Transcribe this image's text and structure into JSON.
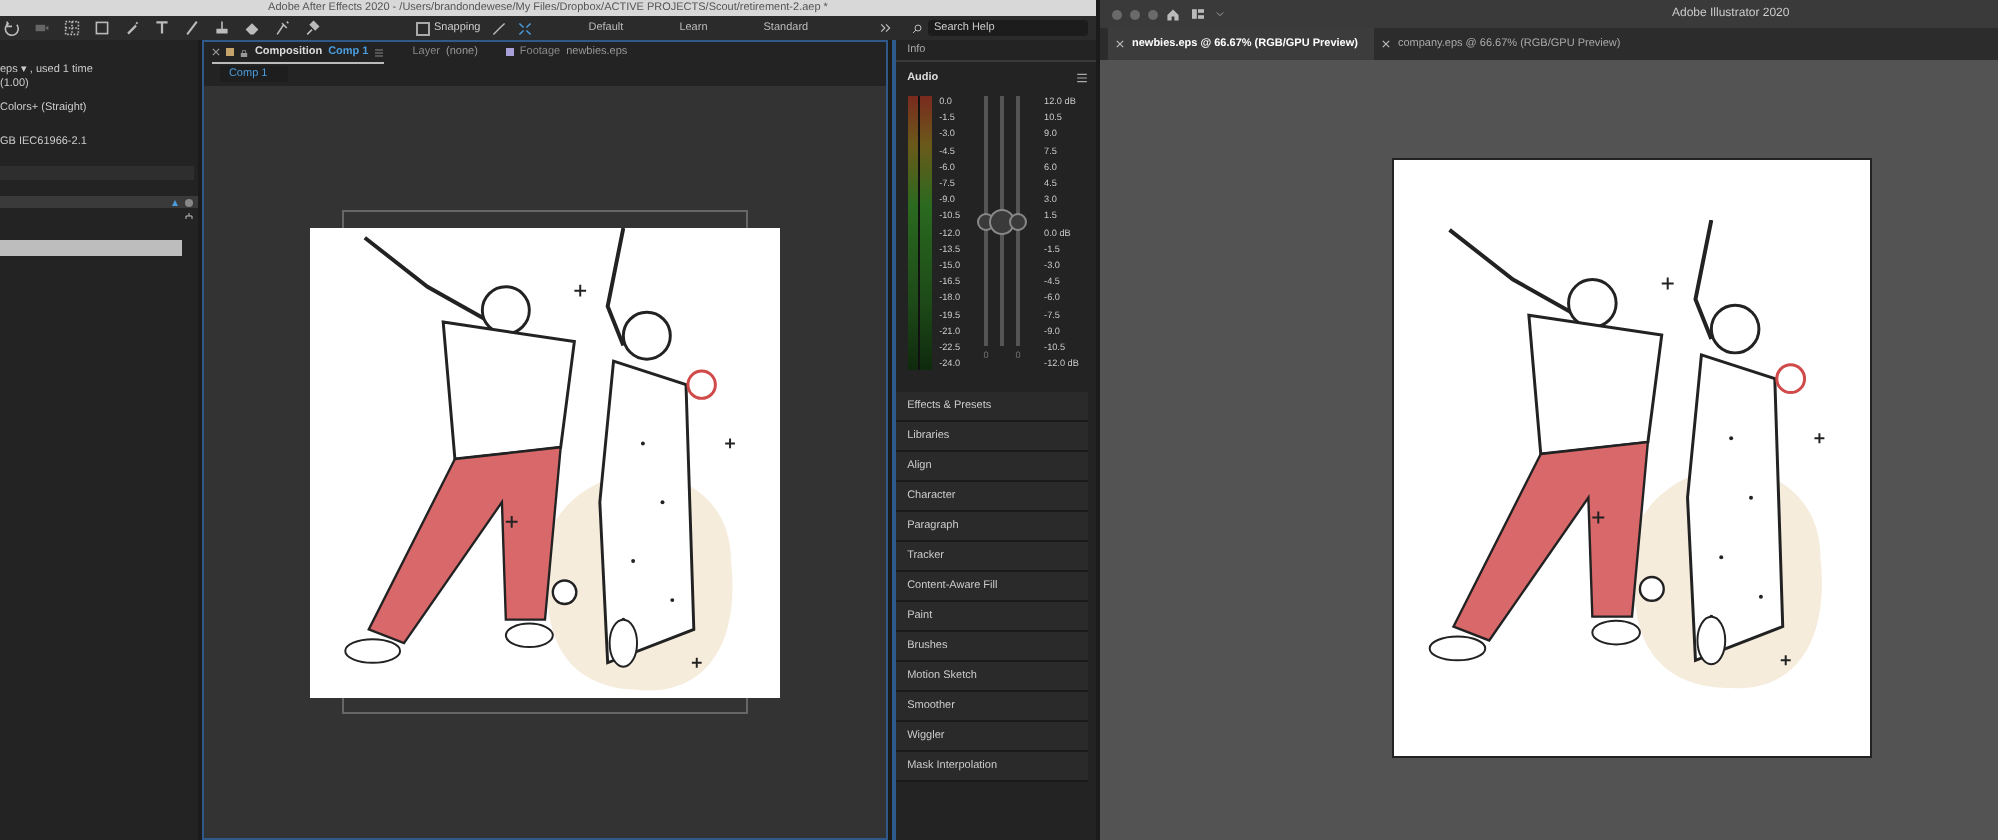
{
  "after_effects": {
    "title": "Adobe After Effects 2020 - /Users/brandondewese/My Files/Dropbox/ACTIVE PROJECTS/Scout/retirement-2.aep *",
    "toolbar": {
      "snapping": {
        "label": "Snapping",
        "checked": false
      },
      "workspaces": [
        {
          "label": "Default",
          "selected": false
        },
        {
          "label": "Learn",
          "selected": false
        },
        {
          "label": "Standard",
          "selected": false
        }
      ],
      "search": {
        "placeholder": "Search Help"
      }
    },
    "project_panel": {
      "lines": [
        "eps ▾ , used 1 time",
        "(1.00)",
        "Colors+ (Straight)",
        "GB IEC61966-2.1"
      ]
    },
    "viewer_tabs": [
      {
        "kind": "composition",
        "label": "Composition",
        "name": "Comp 1",
        "selected": true
      },
      {
        "kind": "layer",
        "label": "Layer",
        "name": "(none)",
        "selected": false
      },
      {
        "kind": "footage",
        "label": "Footage",
        "name": "newbies.eps",
        "selected": false
      }
    ],
    "comp_breadcrumb": "Comp 1",
    "info_panel": {
      "title": "Info"
    },
    "audio": {
      "title": "Audio",
      "left_scale": [
        "0.0",
        "-1.5",
        "-3.0",
        "-4.5",
        "-6.0",
        "-7.5",
        "-9.0",
        "-10.5",
        "-12.0",
        "-13.5",
        "-15.0",
        "-16.5",
        "-18.0",
        "-19.5",
        "-21.0",
        "-22.5",
        "-24.0"
      ],
      "right_scale": [
        "12.0 dB",
        "10.5",
        "9.0",
        "7.5",
        "6.0",
        "4.5",
        "3.0",
        "1.5",
        "0.0 dB",
        "-1.5",
        "-3.0",
        "-4.5",
        "-6.0",
        "-7.5",
        "-9.0",
        "-10.5",
        "-12.0 dB"
      ],
      "sliders": [
        {
          "kind": "channel",
          "level": 0.5,
          "reading": "0"
        },
        {
          "kind": "master",
          "level": 0.5
        },
        {
          "kind": "channel",
          "level": 0.5,
          "reading": "0"
        }
      ]
    },
    "panels": [
      "Effects & Presets",
      "Libraries",
      "Align",
      "Character",
      "Paragraph",
      "Tracker",
      "Content-Aware Fill",
      "Paint",
      "Brushes",
      "Motion Sketch",
      "Smoother",
      "Wiggler",
      "Mask Interpolation"
    ]
  },
  "illustrator": {
    "title": "Adobe Illustrator 2020",
    "tabs": [
      {
        "label": "newbies.eps @ 66.67% (RGB/GPU Preview)",
        "selected": true
      },
      {
        "label": "company.eps @ 66.67% (RGB/GPU Preview)",
        "selected": false
      }
    ]
  }
}
